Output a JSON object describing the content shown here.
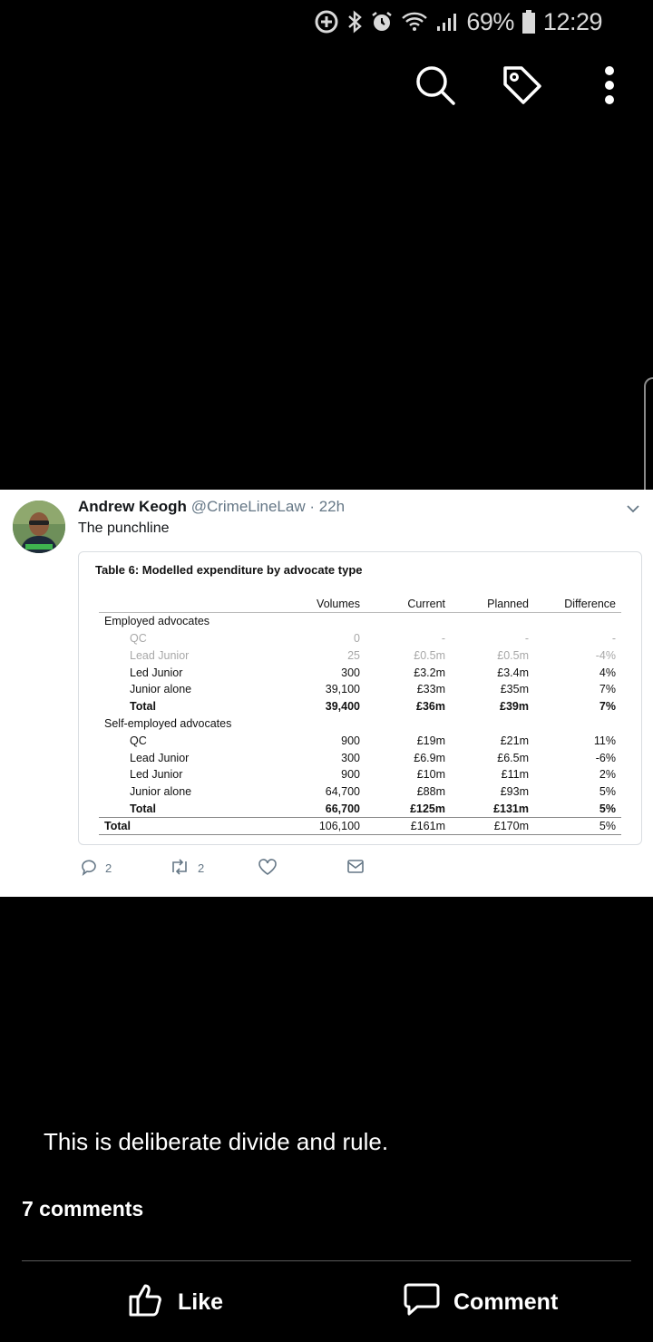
{
  "status_bar": {
    "battery": "69%",
    "time": "12:29"
  },
  "post": {
    "tweet": {
      "author_name": "Andrew Keogh",
      "author_handle": "@CrimeLineLaw · 22h",
      "text": "The punchline",
      "table": {
        "title": "Table 6: Modelled expenditure by advocate type",
        "columns": [
          "",
          "Volumes",
          "Current",
          "Planned",
          "Difference"
        ],
        "rows": [
          {
            "label": "Employed advocates",
            "values": [
              "",
              "",
              "",
              ""
            ],
            "style": "group"
          },
          {
            "label": "QC",
            "values": [
              "0",
              "-",
              "-",
              "-"
            ],
            "style": "muted"
          },
          {
            "label": "Lead Junior",
            "values": [
              "25",
              "£0.5m",
              "£0.5m",
              "-4%"
            ],
            "style": "muted"
          },
          {
            "label": "Led Junior",
            "values": [
              "300",
              "£3.2m",
              "£3.4m",
              "4%"
            ],
            "style": "item"
          },
          {
            "label": "Junior alone",
            "values": [
              "39,100",
              "£33m",
              "£35m",
              "7%"
            ],
            "style": "item"
          },
          {
            "label": "Total",
            "values": [
              "39,400",
              "£36m",
              "£39m",
              "7%"
            ],
            "style": "total"
          },
          {
            "label": "Self-employed advocates",
            "values": [
              "",
              "",
              "",
              ""
            ],
            "style": "group"
          },
          {
            "label": "QC",
            "values": [
              "900",
              "£19m",
              "£21m",
              "11%"
            ],
            "style": "item"
          },
          {
            "label": "Lead Junior",
            "values": [
              "300",
              "£6.9m",
              "£6.5m",
              "-6%"
            ],
            "style": "item"
          },
          {
            "label": "Led Junior",
            "values": [
              "900",
              "£10m",
              "£11m",
              "2%"
            ],
            "style": "item"
          },
          {
            "label": "Junior alone",
            "values": [
              "64,700",
              "£88m",
              "£93m",
              "5%"
            ],
            "style": "item"
          },
          {
            "label": "Total",
            "values": [
              "66,700",
              "£125m",
              "£131m",
              "5%"
            ],
            "style": "total"
          },
          {
            "label": "Total",
            "values": [
              "106,100",
              "£161m",
              "£170m",
              "5%"
            ],
            "style": "grand"
          }
        ]
      },
      "reply_count": "2",
      "retweet_count": "2"
    },
    "caption": "This is deliberate divide and rule.",
    "comments_label": "7 comments",
    "like_label": "Like",
    "comment_label": "Comment"
  }
}
